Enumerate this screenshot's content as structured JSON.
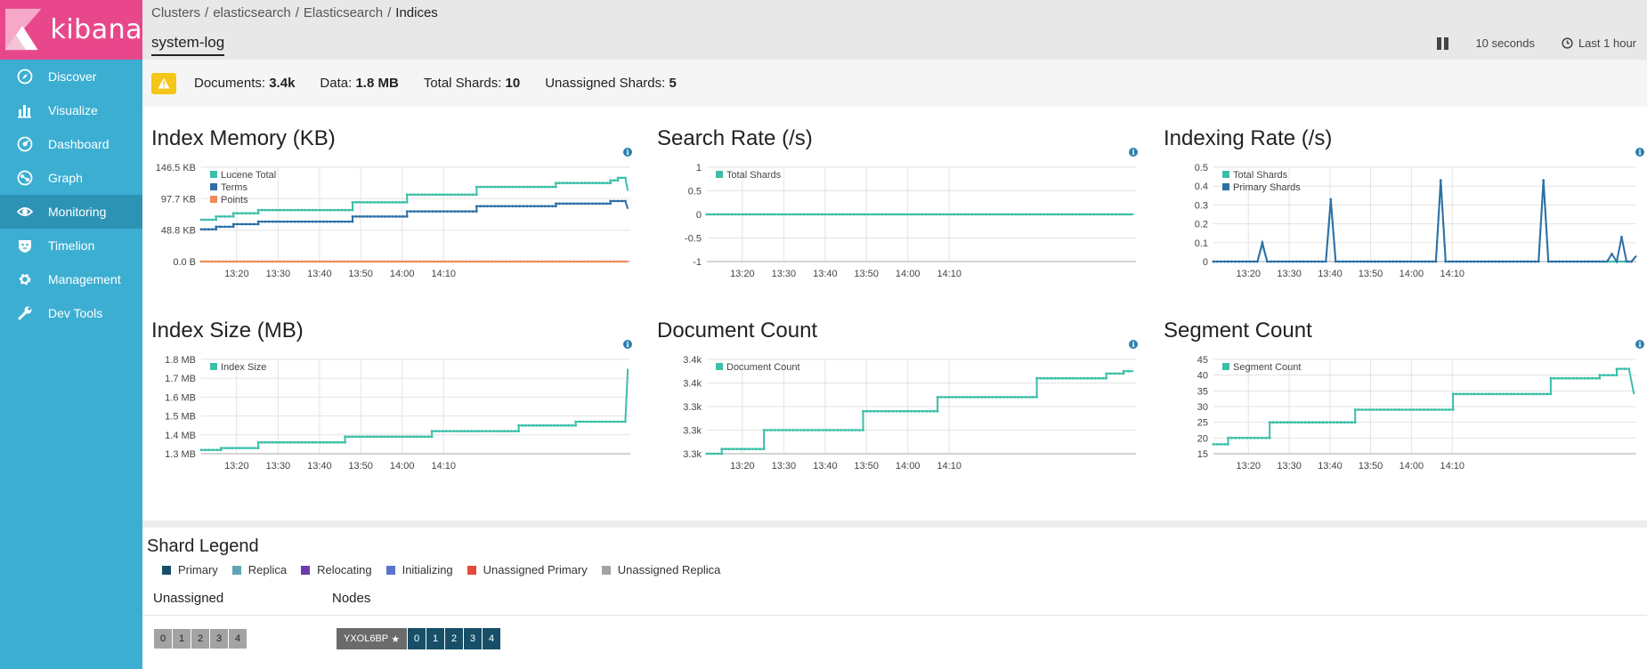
{
  "sidebar": {
    "brand": "kibana",
    "items": [
      {
        "label": "Discover",
        "icon": "compass-icon"
      },
      {
        "label": "Visualize",
        "icon": "bar-chart-icon"
      },
      {
        "label": "Dashboard",
        "icon": "dashboard-icon"
      },
      {
        "label": "Graph",
        "icon": "graph-icon"
      },
      {
        "label": "Monitoring",
        "icon": "eye-icon",
        "active": true
      },
      {
        "label": "Timelion",
        "icon": "timelion-icon"
      },
      {
        "label": "Management",
        "icon": "gear-icon"
      },
      {
        "label": "Dev Tools",
        "icon": "wrench-icon"
      }
    ]
  },
  "header": {
    "breadcrumb": [
      "Clusters",
      "elasticsearch",
      "Elasticsearch",
      "Indices"
    ],
    "title": "system-log",
    "refresh_interval": "10 seconds",
    "time_range": "Last 1 hour"
  },
  "summary": {
    "documents_label": "Documents:",
    "documents": "3.4k",
    "data_label": "Data:",
    "data": "1.8 MB",
    "total_shards_label": "Total Shards:",
    "total_shards": "10",
    "unassigned_label": "Unassigned Shards:",
    "unassigned": "5"
  },
  "colors": {
    "teal": "#3bbfa8",
    "blue": "#2f6fa6",
    "orange": "#ef8a5a",
    "sidebar": "#3caed2",
    "logo": "#e8488b"
  },
  "chart_data": [
    {
      "id": "index-memory",
      "type": "line",
      "title": "Index Memory (KB)",
      "ytick_labels": [
        "146.5 KB",
        "97.7 KB",
        "48.8 KB",
        "0.0 B"
      ],
      "ylim": [
        0,
        146.5
      ],
      "ytick_values": [
        146.5,
        97.7,
        48.8,
        0
      ],
      "xtick_labels": [
        "13:20",
        "13:30",
        "13:40",
        "13:50",
        "14:00",
        "14:10"
      ],
      "series": [
        {
          "name": "Lucene Total",
          "color": "#3bbfa8",
          "points": [
            [
              13.27,
              65
            ],
            [
              13.33,
              65
            ],
            [
              13.33,
              70
            ],
            [
              13.4,
              70
            ],
            [
              13.4,
              75
            ],
            [
              13.5,
              75
            ],
            [
              13.5,
              80
            ],
            [
              13.88,
              80
            ],
            [
              13.88,
              92
            ],
            [
              14.1,
              92
            ],
            [
              14.1,
              104
            ],
            [
              14.38,
              104
            ],
            [
              14.38,
              116
            ],
            [
              14.7,
              116
            ],
            [
              14.7,
              122
            ],
            [
              14.92,
              122
            ],
            [
              14.92,
              126
            ],
            [
              14.95,
              126
            ],
            [
              14.95,
              130
            ],
            [
              14.98,
              130
            ],
            [
              14.99,
              110
            ]
          ]
        },
        {
          "name": "Terms",
          "color": "#2f6fa6",
          "points": [
            [
              13.27,
              50
            ],
            [
              13.33,
              50
            ],
            [
              13.33,
              54
            ],
            [
              13.4,
              54
            ],
            [
              13.4,
              58
            ],
            [
              13.5,
              58
            ],
            [
              13.5,
              62
            ],
            [
              13.88,
              62
            ],
            [
              13.88,
              70
            ],
            [
              14.1,
              70
            ],
            [
              14.1,
              78
            ],
            [
              14.38,
              78
            ],
            [
              14.38,
              86
            ],
            [
              14.7,
              86
            ],
            [
              14.7,
              90
            ],
            [
              14.92,
              90
            ],
            [
              14.92,
              94
            ],
            [
              14.98,
              94
            ],
            [
              14.99,
              82
            ]
          ]
        },
        {
          "name": "Points",
          "color": "#ef8a5a",
          "points": [
            [
              13.27,
              0
            ],
            [
              14.99,
              0
            ]
          ]
        }
      ]
    },
    {
      "id": "search-rate",
      "type": "line",
      "title": "Search Rate (/s)",
      "ytick_labels": [
        "1",
        "0.5",
        "0",
        "-0.5",
        "-1"
      ],
      "ylim": [
        -1,
        1
      ],
      "ytick_values": [
        1,
        0.5,
        0,
        -0.5,
        -1
      ],
      "xtick_labels": [
        "13:20",
        "13:30",
        "13:40",
        "13:50",
        "14:00",
        "14:10"
      ],
      "series": [
        {
          "name": "Total Shards",
          "color": "#3bbfa8",
          "points": [
            [
              13.27,
              0
            ],
            [
              14.99,
              0
            ]
          ]
        }
      ]
    },
    {
      "id": "indexing-rate",
      "type": "line",
      "title": "Indexing Rate (/s)",
      "ytick_labels": [
        "0.5",
        "0.4",
        "0.3",
        "0.2",
        "0.1",
        "0"
      ],
      "ylim": [
        0,
        0.5
      ],
      "ytick_values": [
        0.5,
        0.4,
        0.3,
        0.2,
        0.1,
        0
      ],
      "xtick_labels": [
        "13:20",
        "13:30",
        "13:40",
        "13:50",
        "14:00",
        "14:10"
      ],
      "series": [
        {
          "name": "Total Shards",
          "color": "#3bbfa8",
          "points": [
            [
              13.27,
              0
            ],
            [
              13.45,
              0
            ],
            [
              13.47,
              0.09
            ],
            [
              13.49,
              0
            ],
            [
              13.73,
              0
            ],
            [
              13.75,
              0.32
            ],
            [
              13.77,
              0
            ],
            [
              14.18,
              0
            ],
            [
              14.2,
              0.43
            ],
            [
              14.22,
              0
            ],
            [
              14.6,
              0
            ],
            [
              14.62,
              0.43
            ],
            [
              14.64,
              0
            ],
            [
              14.98,
              0
            ],
            [
              15.0,
              0.03
            ]
          ]
        },
        {
          "name": "Primary Shards",
          "color": "#2f6fa6",
          "points": [
            [
              13.27,
              0
            ],
            [
              13.45,
              0
            ],
            [
              13.47,
              0.1
            ],
            [
              13.49,
              0
            ],
            [
              13.73,
              0
            ],
            [
              13.75,
              0.33
            ],
            [
              13.77,
              0
            ],
            [
              14.18,
              0
            ],
            [
              14.2,
              0.43
            ],
            [
              14.22,
              0
            ],
            [
              14.6,
              0
            ],
            [
              14.62,
              0.43
            ],
            [
              14.64,
              0
            ],
            [
              14.88,
              0
            ],
            [
              14.9,
              0.04
            ],
            [
              14.92,
              0
            ],
            [
              14.94,
              0.13
            ],
            [
              14.96,
              0
            ],
            [
              14.98,
              0
            ],
            [
              15.0,
              0.03
            ]
          ]
        }
      ]
    },
    {
      "id": "index-size",
      "type": "line",
      "title": "Index Size (MB)",
      "ytick_labels": [
        "1.8 MB",
        "1.7 MB",
        "1.6 MB",
        "1.5 MB",
        "1.4 MB",
        "1.3 MB"
      ],
      "ylim": [
        1.3,
        1.8
      ],
      "ytick_values": [
        1.8,
        1.7,
        1.6,
        1.5,
        1.4,
        1.3
      ],
      "xtick_labels": [
        "13:20",
        "13:30",
        "13:40",
        "13:50",
        "14:00",
        "14:10"
      ],
      "series": [
        {
          "name": "Index Size",
          "color": "#3bbfa8",
          "points": [
            [
              13.27,
              1.32
            ],
            [
              13.35,
              1.32
            ],
            [
              13.35,
              1.33
            ],
            [
              13.5,
              1.33
            ],
            [
              13.5,
              1.36
            ],
            [
              13.85,
              1.36
            ],
            [
              13.85,
              1.39
            ],
            [
              14.2,
              1.39
            ],
            [
              14.2,
              1.42
            ],
            [
              14.55,
              1.42
            ],
            [
              14.55,
              1.45
            ],
            [
              14.78,
              1.45
            ],
            [
              14.78,
              1.47
            ],
            [
              14.98,
              1.47
            ],
            [
              14.99,
              1.75
            ]
          ]
        }
      ]
    },
    {
      "id": "document-count",
      "type": "line",
      "title": "Document Count",
      "ytick_labels": [
        "3.4k",
        "3.4k",
        "3.3k",
        "3.3k",
        "3.3k"
      ],
      "ytick_values": [
        3.42,
        3.37,
        3.32,
        3.27,
        3.22
      ],
      "ylim": [
        3.22,
        3.42
      ],
      "xtick_labels": [
        "13:20",
        "13:30",
        "13:40",
        "13:50",
        "14:00",
        "14:10"
      ],
      "series": [
        {
          "name": "Document Count",
          "color": "#3bbfa8",
          "points": [
            [
              13.27,
              3.22
            ],
            [
              13.33,
              3.22
            ],
            [
              13.33,
              3.23
            ],
            [
              13.5,
              3.23
            ],
            [
              13.5,
              3.27
            ],
            [
              13.9,
              3.27
            ],
            [
              13.9,
              3.31
            ],
            [
              14.2,
              3.31
            ],
            [
              14.2,
              3.34
            ],
            [
              14.6,
              3.34
            ],
            [
              14.6,
              3.38
            ],
            [
              14.88,
              3.38
            ],
            [
              14.88,
              3.39
            ],
            [
              14.95,
              3.39
            ],
            [
              14.95,
              3.395
            ],
            [
              14.99,
              3.395
            ]
          ]
        }
      ]
    },
    {
      "id": "segment-count",
      "type": "line",
      "title": "Segment Count",
      "ytick_labels": [
        "45",
        "40",
        "35",
        "30",
        "25",
        "20",
        "15"
      ],
      "ylim": [
        15,
        45
      ],
      "ytick_values": [
        45,
        40,
        35,
        30,
        25,
        20,
        15
      ],
      "xtick_labels": [
        "13:20",
        "13:30",
        "13:40",
        "13:50",
        "14:00",
        "14:10"
      ],
      "series": [
        {
          "name": "Segment Count",
          "color": "#3bbfa8",
          "points": [
            [
              13.27,
              18
            ],
            [
              13.33,
              18
            ],
            [
              13.33,
              20
            ],
            [
              13.5,
              20
            ],
            [
              13.5,
              25
            ],
            [
              13.85,
              25
            ],
            [
              13.85,
              29
            ],
            [
              14.25,
              29
            ],
            [
              14.25,
              34
            ],
            [
              14.65,
              34
            ],
            [
              14.65,
              39
            ],
            [
              14.85,
              39
            ],
            [
              14.85,
              40
            ],
            [
              14.92,
              40
            ],
            [
              14.92,
              42
            ],
            [
              14.97,
              42
            ],
            [
              14.99,
              34
            ]
          ]
        }
      ]
    }
  ],
  "shard_legend": {
    "title": "Shard Legend",
    "items": [
      {
        "label": "Primary",
        "color": "#164f67"
      },
      {
        "label": "Replica",
        "color": "#5ea5b5"
      },
      {
        "label": "Relocating",
        "color": "#6c3bb0"
      },
      {
        "label": "Initializing",
        "color": "#5b74cc"
      },
      {
        "label": "Unassigned Primary",
        "color": "#e24b3b"
      },
      {
        "label": "Unassigned Replica",
        "color": "#a3a3a3"
      }
    ],
    "unassigned_heading": "Unassigned",
    "nodes_heading": "Nodes",
    "unassigned_shards": [
      "0",
      "1",
      "2",
      "3",
      "4"
    ],
    "node_name": "YXOL6BP",
    "node_star": "★",
    "node_shards": [
      "0",
      "1",
      "2",
      "3",
      "4"
    ]
  }
}
